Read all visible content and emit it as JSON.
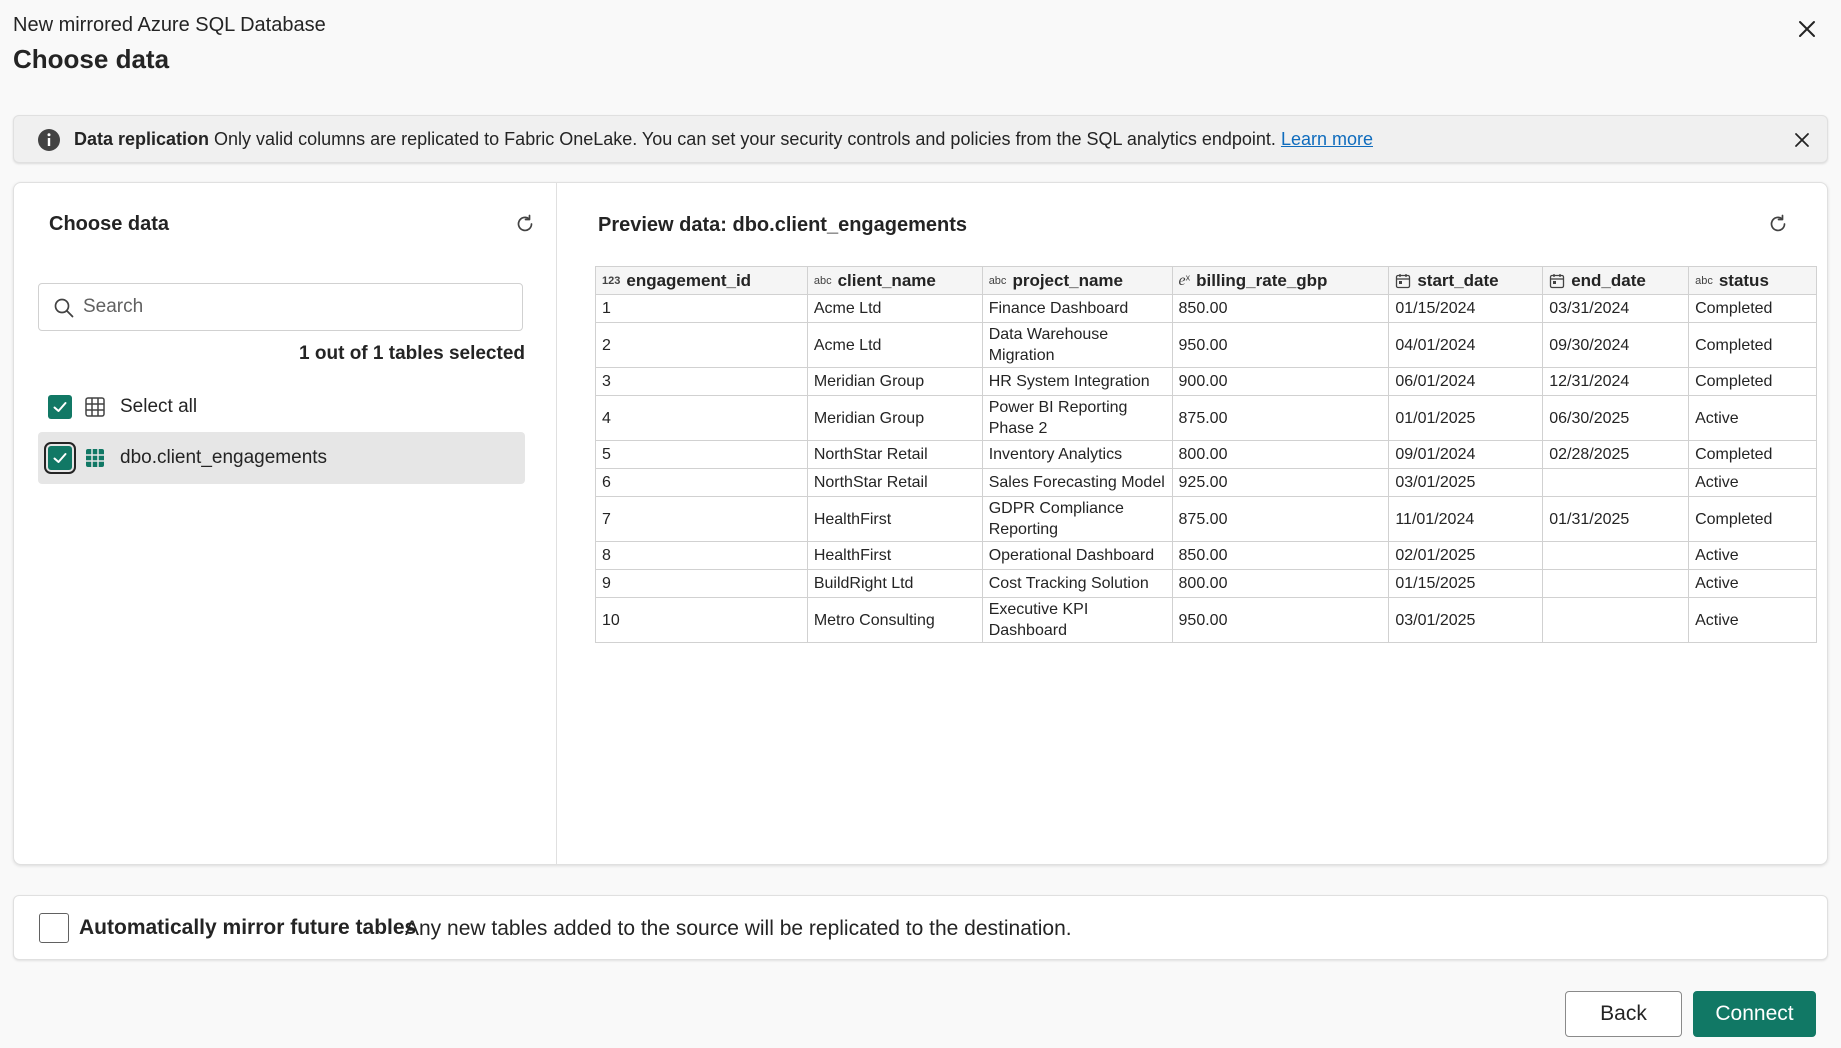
{
  "header": {
    "subtitle": "New mirrored Azure SQL Database",
    "title": "Choose data"
  },
  "banner": {
    "title": "Data replication",
    "message": " Only valid columns are replicated to Fabric OneLake. You can set your security controls and policies from the SQL analytics endpoint. ",
    "link": "Learn more"
  },
  "left_pane": {
    "title": "Choose data",
    "search_placeholder": "Search",
    "selection_count": "1 out of 1 tables selected",
    "select_all_label": "Select all",
    "table_label": "dbo.client_engagements"
  },
  "preview": {
    "title": "Preview data: dbo.client_engagements",
    "columns": [
      {
        "type": "123",
        "name": "engagement_id"
      },
      {
        "type": "abc",
        "name": "client_name"
      },
      {
        "type": "abc",
        "name": "project_name"
      },
      {
        "type": "decimal",
        "name": "billing_rate_gbp"
      },
      {
        "type": "date",
        "name": "start_date"
      },
      {
        "type": "date",
        "name": "end_date"
      },
      {
        "type": "abc",
        "name": "status"
      }
    ],
    "rows": [
      [
        "1",
        "Acme Ltd",
        "Finance Dashboard",
        "850.00",
        "01/15/2024",
        "03/31/2024",
        "Completed"
      ],
      [
        "2",
        "Acme Ltd",
        "Data Warehouse Migration",
        "950.00",
        "04/01/2024",
        "09/30/2024",
        "Completed"
      ],
      [
        "3",
        "Meridian Group",
        "HR System Integration",
        "900.00",
        "06/01/2024",
        "12/31/2024",
        "Completed"
      ],
      [
        "4",
        "Meridian Group",
        "Power BI Reporting Phase 2",
        "875.00",
        "01/01/2025",
        "06/30/2025",
        "Active"
      ],
      [
        "5",
        "NorthStar Retail",
        "Inventory Analytics",
        "800.00",
        "09/01/2024",
        "02/28/2025",
        "Completed"
      ],
      [
        "6",
        "NorthStar Retail",
        "Sales Forecasting Model",
        "925.00",
        "03/01/2025",
        "",
        "Active"
      ],
      [
        "7",
        "HealthFirst",
        "GDPR Compliance Reporting",
        "875.00",
        "11/01/2024",
        "01/31/2025",
        "Completed"
      ],
      [
        "8",
        "HealthFirst",
        "Operational Dashboard",
        "850.00",
        "02/01/2025",
        "",
        "Active"
      ],
      [
        "9",
        "BuildRight Ltd",
        "Cost Tracking Solution",
        "800.00",
        "01/15/2025",
        "",
        "Active"
      ],
      [
        "10",
        "Metro Consulting",
        "Executive KPI Dashboard",
        "950.00",
        "03/01/2025",
        "",
        "Active"
      ]
    ],
    "tall_rows": [
      1,
      3,
      6,
      9
    ]
  },
  "mirror": {
    "label": "Automatically mirror future tables",
    "description": "Any new tables added to the source will be replicated to the destination."
  },
  "buttons": {
    "back": "Back",
    "connect": "Connect"
  },
  "colors": {
    "accent": "#117865",
    "link": "#0f6cbd"
  }
}
